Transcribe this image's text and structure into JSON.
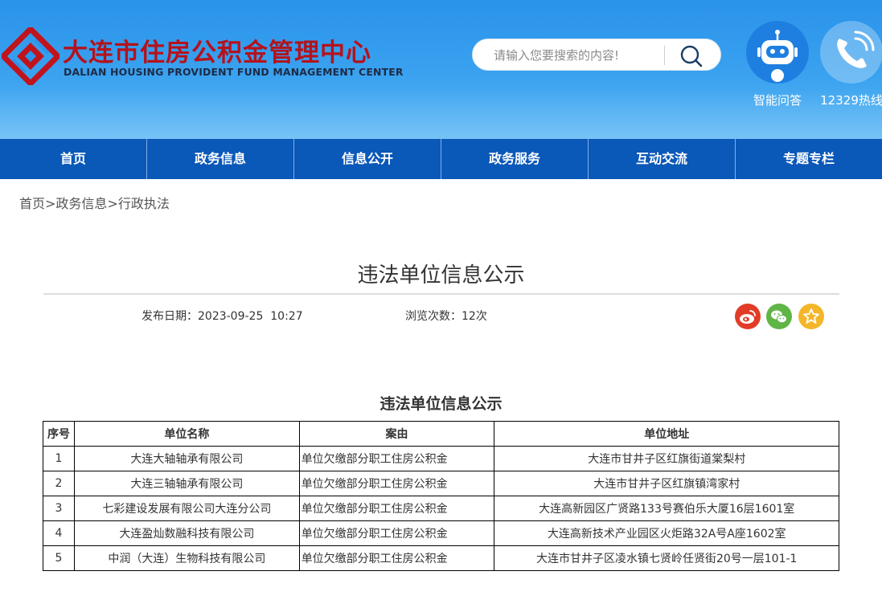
{
  "header": {
    "logo_cn": "大连市住房公积金管理中心",
    "logo_en": "DALIAN HOUSING PROVIDENT FUND MANAGEMENT CENTER",
    "search_placeholder": "请输入您要搜索的内容!",
    "search_icon": "search-icon",
    "quick_links": [
      {
        "label": "智能问答",
        "icon": "robot-icon"
      },
      {
        "label": "12329热线",
        "icon": "phone-icon"
      }
    ],
    "brand_color": "#b5121b",
    "header_color": "#2a93ea"
  },
  "nav": {
    "items": [
      "首页",
      "政务信息",
      "信息公开",
      "政务服务",
      "互动交流",
      "专题专栏"
    ],
    "color": "#0a58b8"
  },
  "breadcrumb": [
    "首页",
    "政务信息",
    "行政执法"
  ],
  "breadcrumb_sep": ">",
  "article": {
    "title": "违法单位信息公示",
    "date_label": "发布日期：",
    "date_value": "2023-09-25  10:27",
    "views_label": "浏览次数：",
    "views_value": "12次",
    "share_icons": [
      "weibo-icon",
      "wechat-icon",
      "favorite-icon"
    ],
    "subtitle": "违法单位信息公示"
  },
  "table": {
    "headers": [
      "序号",
      "单位名称",
      "案由",
      "单位地址"
    ],
    "rows": [
      [
        "1",
        "大连大轴轴承有限公司",
        "单位欠缴部分职工住房公积金",
        "大连市甘井子区红旗街道棠梨村"
      ],
      [
        "2",
        "大连三轴轴承有限公司",
        "单位欠缴部分职工住房公积金",
        "大连市甘井子区红旗镇湾家村"
      ],
      [
        "3",
        "七彩建设发展有限公司大连分公司",
        "单位欠缴部分职工住房公积金",
        "大连高新园区广贤路133号赛伯乐大厦16层1601室"
      ],
      [
        "4",
        "大连盈灿数融科技有限公司",
        "单位欠缴部分职工住房公积金",
        "大连高新技术产业园区火炬路32A号A座1602室"
      ],
      [
        "5",
        "中润（大连）生物科技有限公司",
        "单位欠缴部分职工住房公积金",
        "大连市甘井子区凌水镇七贤岭任贤街20号一层101-1"
      ]
    ]
  }
}
